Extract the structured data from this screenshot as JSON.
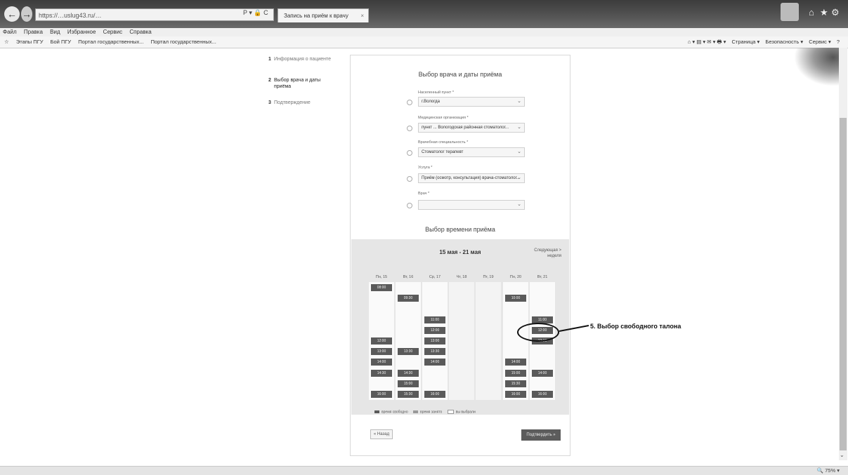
{
  "browser": {
    "address": "https://…uslug43.ru/…",
    "addr_icons": "P ▾ 🔒 C",
    "tab_label": "Запись на приём к врачу",
    "tab_close": "×",
    "menu": [
      "Файл",
      "Правка",
      "Вид",
      "Избранное",
      "Сервис",
      "Справка"
    ],
    "favorites": [
      "Этапы ПГУ",
      "Бой ПГУ",
      "Портал государственных...",
      "Портал государственных..."
    ],
    "command_items": [
      "Страница ▾",
      "Безопасность ▾",
      "Сервис ▾"
    ],
    "zoom": "75%"
  },
  "steps": [
    {
      "num": "1",
      "label": "Информация о пациенте"
    },
    {
      "num": "2",
      "label": "Выбор врача и даты приёма"
    },
    {
      "num": "3",
      "label": "Подтверждение"
    }
  ],
  "form": {
    "title": "Выбор врача и даты приёма",
    "fields": [
      {
        "label": "Населенный пункт *",
        "value": "г.Вологда"
      },
      {
        "label": "Медицинская организация *",
        "value": "пункт ... Вологодская районная стоматолог..."
      },
      {
        "label": "Врачебная специальность *",
        "value": "Стоматолог терапевт"
      },
      {
        "label": "Услуга *",
        "value": "Приём (осмотр, консультация) врача-стоматолог..."
      },
      {
        "label": "Врач *",
        "value": ""
      }
    ]
  },
  "calendar": {
    "title": "Выбор времени приёма",
    "week_range": "15 мая - 21 мая",
    "next_week": "Следующая > неделя",
    "days": [
      {
        "label": "Пн, 15",
        "slots": [
          "08:00",
          "",
          "",
          "",
          "",
          "12:00",
          "13:00",
          "14:00",
          "14:30",
          "",
          "16:00"
        ]
      },
      {
        "label": "Вт, 16",
        "slots": [
          "",
          "09:30",
          "",
          "",
          "",
          "",
          "13:30",
          "",
          "14:30",
          "15:00",
          "15:30"
        ]
      },
      {
        "label": "Ср, 17",
        "slots": [
          "",
          "",
          "",
          "11:00",
          "12:00",
          "13:00",
          "13:30",
          "14:00",
          "",
          "",
          "16:00"
        ]
      },
      {
        "label": "Чт, 18",
        "slots": []
      },
      {
        "label": "Пт, 19",
        "slots": []
      },
      {
        "label": "Пн, 20",
        "slots": [
          "",
          "10:00",
          "",
          "",
          "",
          "",
          "",
          "14:00",
          "15:00",
          "15:30",
          "16:00"
        ]
      },
      {
        "label": "Вт, 21",
        "slots": [
          "",
          "",
          "",
          "11:00",
          "12:00",
          "12:30",
          "",
          "",
          "14:00",
          "",
          "16:00"
        ]
      }
    ],
    "legend": [
      "время свободно",
      "время занято",
      "вы выбрали"
    ]
  },
  "buttons": {
    "back": "« Назад",
    "submit": "Подтвердить »"
  },
  "annotation": "5. Выбор свободного талона",
  "colors": {
    "slot_free": "#5a5a5a",
    "calendar_bg": "#e6e6e6",
    "titlebar": "#4a4a4a"
  }
}
